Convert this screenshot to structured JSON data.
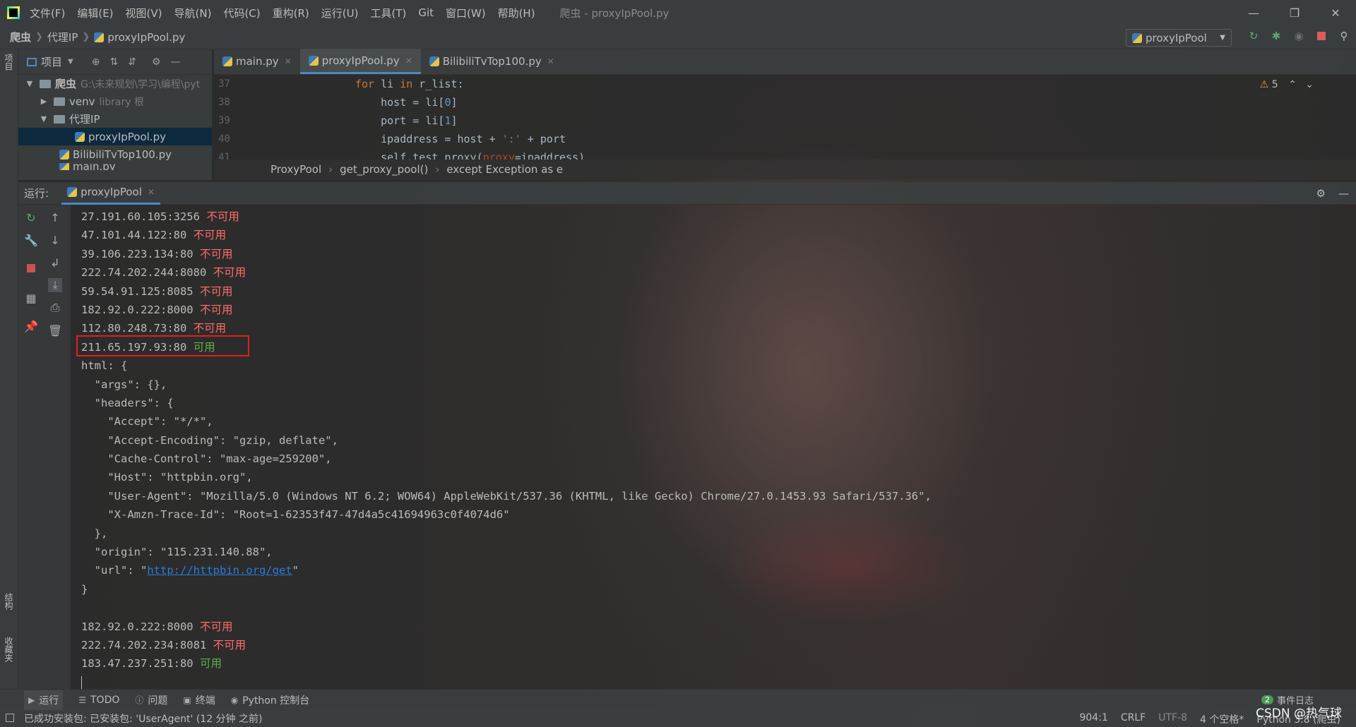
{
  "window": {
    "title": "爬虫 - proxyIpPool.py",
    "menu": [
      "文件(F)",
      "编辑(E)",
      "视图(V)",
      "导航(N)",
      "代码(C)",
      "重构(R)",
      "运行(U)",
      "工具(T)",
      "Git",
      "窗口(W)",
      "帮助(H)"
    ]
  },
  "navbar": {
    "crumbs": [
      "爬虫",
      "代理IP",
      "proxyIpPool.py"
    ],
    "run_config": "proxyIpPool"
  },
  "project": {
    "title": "项目",
    "root": {
      "name": "爬虫",
      "path": "G:\\未来规划\\学习\\编程\\pyt"
    },
    "venv": {
      "name": "venv",
      "hint": "library 根"
    },
    "folder": "代理IP",
    "files": [
      "proxyIpPool.py",
      "BilibiliTvTop100.py",
      "main.py"
    ]
  },
  "stripe": {
    "project": "项目",
    "structure": "结构",
    "favorites": "收藏夹"
  },
  "editor": {
    "tabs": [
      "main.py",
      "proxyIpPool.py",
      "BilibiliTvTop100.py"
    ],
    "line_numbers": [
      "37",
      "38",
      "39",
      "40",
      "41"
    ],
    "warnings": "5",
    "breadcrumb": [
      "ProxyPool",
      "get_proxy_pool()",
      "except Exception as e"
    ]
  },
  "run": {
    "label": "运行:",
    "tab": "proxyIpPool"
  },
  "console": {
    "unavailable": "不可用",
    "available": "可用",
    "url": "http://httpbin.org/get",
    "proxies_top": [
      {
        "addr": "27.191.60.105:3256",
        "ok": false
      },
      {
        "addr": "47.101.44.122:80",
        "ok": false
      },
      {
        "addr": "39.106.223.134:80",
        "ok": false
      },
      {
        "addr": "222.74.202.244:8080",
        "ok": false
      },
      {
        "addr": "59.54.91.125:8085",
        "ok": false
      },
      {
        "addr": "182.92.0.222:8000",
        "ok": false
      },
      {
        "addr": "112.80.248.73:80",
        "ok": false
      },
      {
        "addr": "211.65.197.93:80",
        "ok": true
      }
    ],
    "proxies_bottom": [
      {
        "addr": "182.92.0.222:8000",
        "ok": false
      },
      {
        "addr": "222.74.202.234:8081",
        "ok": false
      },
      {
        "addr": "183.47.237.251:80",
        "ok": true
      }
    ]
  },
  "bottom_tabs": [
    "运行",
    "TODO",
    "问题",
    "终端",
    "Python 控制台"
  ],
  "event_log": {
    "count": "2",
    "label": "事件日志"
  },
  "status": {
    "message": "已成功安装包: 已安装包: 'UserAgent' (12 分钟 之前)",
    "position": "904:1",
    "line_sep": "CRLF",
    "encoding": "UTF-8",
    "indent": "4 个空格*",
    "interpreter": "Python 3.8 (爬虫)"
  },
  "watermark": "CSDN @热气球"
}
